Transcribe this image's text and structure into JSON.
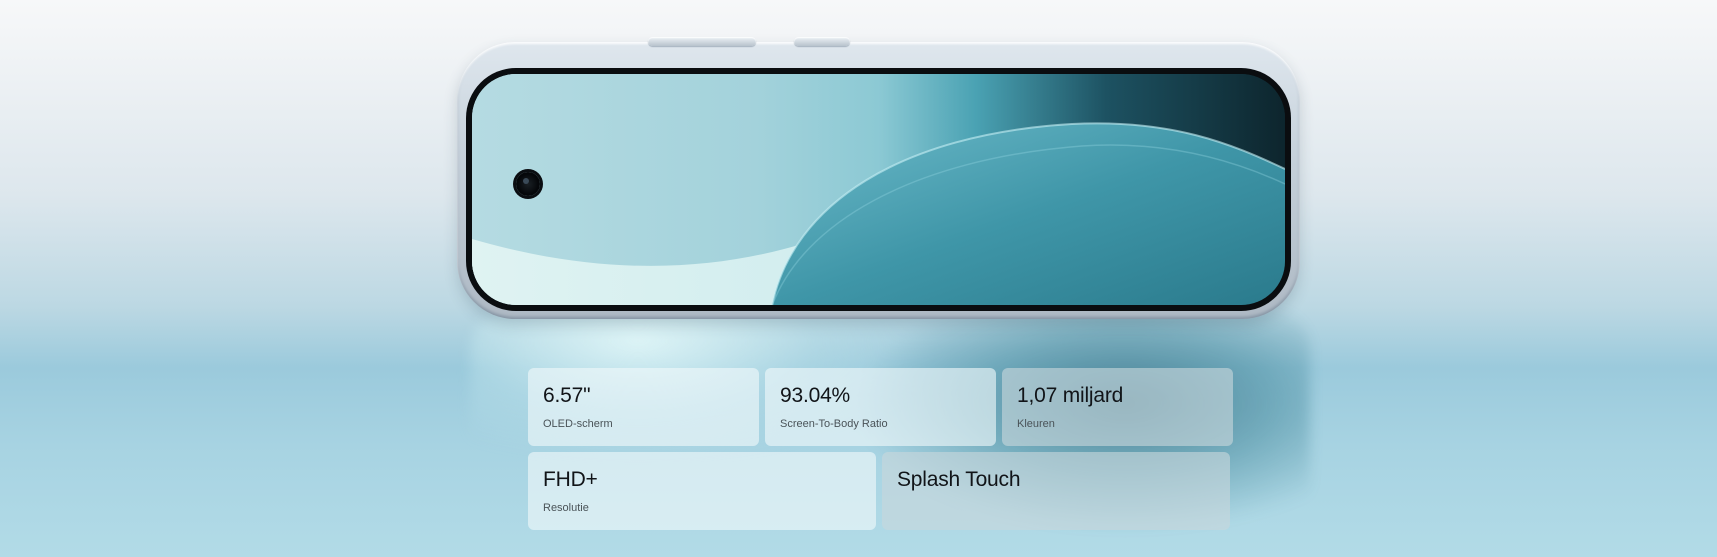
{
  "specs": {
    "row1": [
      {
        "value": "6.57\"",
        "label": "OLED-scherm"
      },
      {
        "value": "93.04%",
        "label": "Screen-To-Body Ratio"
      },
      {
        "value": "1,07 miljard",
        "label": "Kleuren"
      }
    ],
    "row2": [
      {
        "value": "FHD+",
        "label": "Resolutie"
      },
      {
        "value": "Splash Touch",
        "label": ""
      }
    ]
  },
  "colors": {
    "background_top": "#f7f8f9",
    "background_bottom": "#9bcadc",
    "screen_light": "#b7dde4",
    "screen_dark": "#0f2a33",
    "card_text": "#111418"
  },
  "icons": {
    "camera": "front-camera-icon"
  }
}
